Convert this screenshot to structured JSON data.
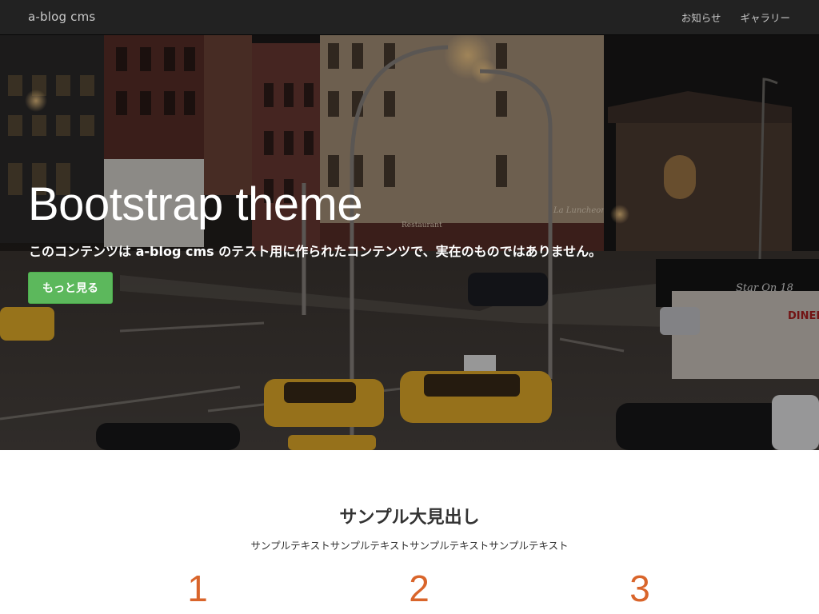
{
  "navbar": {
    "brand": "a-blog cms",
    "links": [
      {
        "label": "お知らせ"
      },
      {
        "label": "ギャラリー"
      }
    ]
  },
  "hero": {
    "title": "Bootstrap theme",
    "subtitle": "このコンテンツは a-blog cms のテスト用に作られたコンテンツで、実在のものではありません。",
    "button_label": "もっと見る",
    "signs": {
      "restaurant": "Restaurant",
      "star": "Star On 18",
      "diner": "DINER",
      "luncheonette": "La Luncheonette"
    }
  },
  "section": {
    "title": "サンプル大見出し",
    "text": "サンプルテキストサンプルテキストサンプルテキストサンプルテキスト",
    "numbers": [
      "1",
      "2",
      "3"
    ]
  },
  "colors": {
    "navbar_bg": "#222222",
    "button_bg": "#5cb85c",
    "number_color": "#d9652b"
  }
}
